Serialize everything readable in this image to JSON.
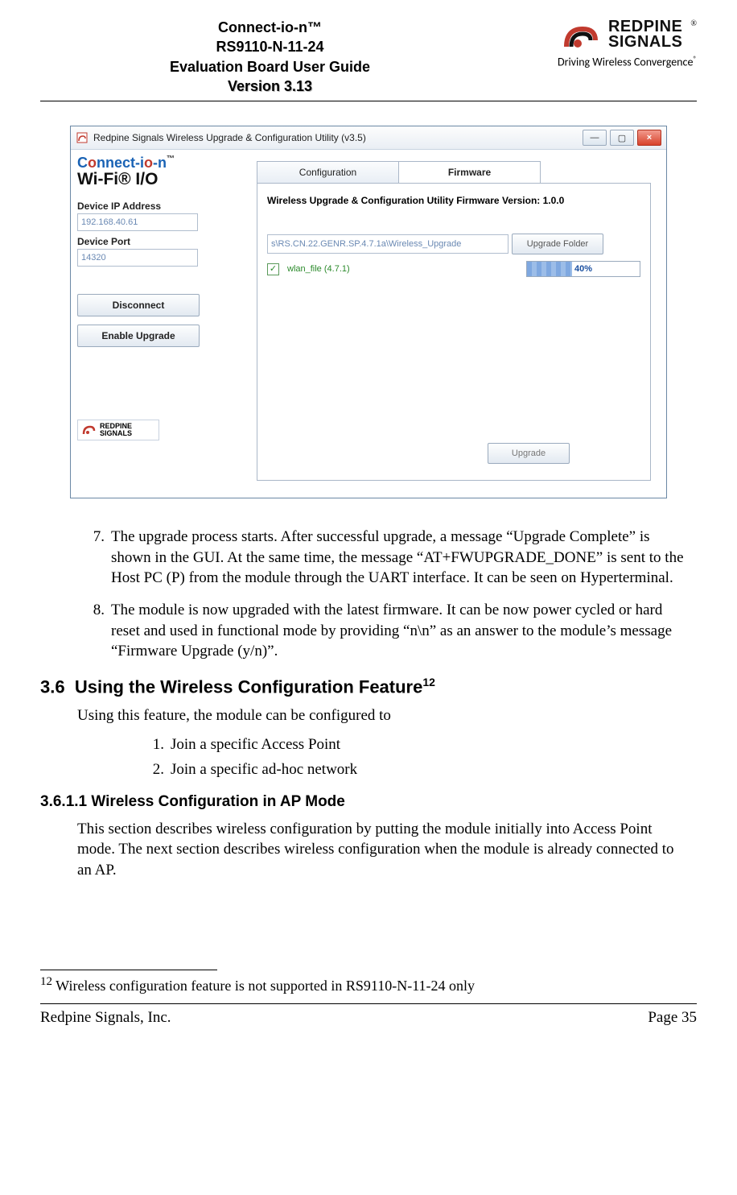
{
  "header": {
    "product": "Connect-io-n™",
    "model": "RS9110-N-11-24",
    "guide": "Evaluation Board User Guide",
    "version": "Version 3.13",
    "brand_top": "REDPINE",
    "brand_bottom": "SIGNALS",
    "reg": "®",
    "tagline": "Driving Wireless Convergence",
    "tagline_reg": "®"
  },
  "app": {
    "title": "Redpine Signals Wireless Upgrade & Configuration Utility (v3.5)",
    "win": {
      "min": "—",
      "max": "▢",
      "close": "×"
    },
    "left": {
      "logo_line1_prefix": "C",
      "logo_line1_mid_a": "o",
      "logo_line1_mid_b": "nnect-i",
      "logo_line1_o2": "o",
      "logo_line1_suffix": "-n",
      "logo_tm": "™",
      "logo_line2": "Wi-Fi®  I/O",
      "ip_label": "Device IP Address",
      "ip_value": "192.168.40.61",
      "port_label": "Device Port",
      "port_value": "14320",
      "btn_disconnect": "Disconnect",
      "btn_enable": "Enable Upgrade",
      "mini_top": "REDPINE",
      "mini_bot": "SIGNALS"
    },
    "tabs": {
      "config": "Configuration",
      "firmware": "Firmware"
    },
    "fw_version": "Wireless Upgrade & Configuration Utility Firmware Version: 1.0.0",
    "path": "s\\RS.CN.22.GENR.SP.4.7.1a\\Wireless_Upgrade",
    "folder_btn": "Upgrade Folder",
    "file_checked": "✓",
    "file_name": "wlan_file (4.7.1)",
    "progress_pct": 40,
    "progress_label": "40%",
    "upgrade_btn": "Upgrade"
  },
  "list": {
    "item7_num": "7.",
    "item7": "The upgrade process starts. After successful upgrade, a message “Upgrade Complete” is shown in the GUI. At the same time, the message “AT+FWUPGRADE_DONE” is sent to the Host PC (P) from the module through the UART interface. It can be seen on Hyperterminal.",
    "item8_num": "8.",
    "item8": "The module is now upgraded with the latest firmware. It can be now power cycled or hard reset and used in functional mode by providing “n\\n” as an answer to the module’s message “Firmware Upgrade (y/n)”."
  },
  "sec": {
    "num": "3.6",
    "title": "Using the Wireless Configuration Feature",
    "fnref": "12",
    "intro": "Using this feature, the module can be configured to",
    "sub1_num": "1.",
    "sub1": "Join a specific Access Point",
    "sub2_num": "2.",
    "sub2": "Join a specific ad-hoc network",
    "subsec_num": "3.6.1.1",
    "subsec_title": "Wireless Configuration in AP Mode",
    "subsec_body": "This section describes wireless configuration by putting the module initially into Access Point mode. The next section describes wireless configuration when the module is already connected to an AP."
  },
  "footnote": {
    "marker": "12",
    "text": " Wireless configuration feature is not supported in RS9110-N-11-24 only"
  },
  "footer": {
    "left": "Redpine Signals, Inc.",
    "right": "Page 35"
  }
}
